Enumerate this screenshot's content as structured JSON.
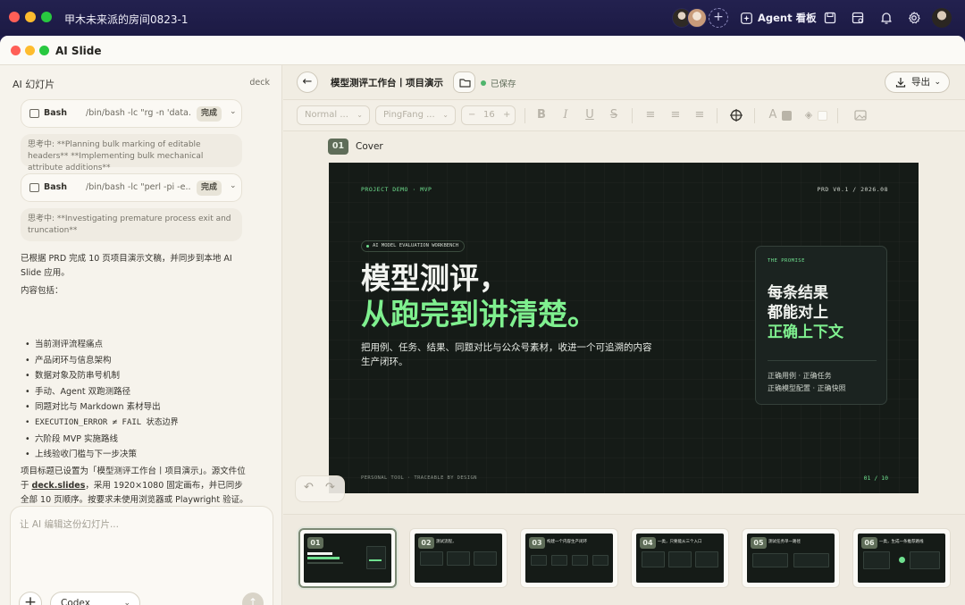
{
  "window": {
    "title": "甲木未来派的房间0823-1",
    "agent_board_label": "Agent 看板",
    "add_member_label": "+"
  },
  "app": {
    "title": "AI Slide"
  },
  "chat": {
    "header_title": "AI 幻灯片",
    "header_tag": "deck",
    "tool_calls": [
      {
        "name": "Bash",
        "command": "/bin/bash -lc \"rg -n 'data...",
        "status": "完成"
      },
      {
        "name": "Bash",
        "command": "/bin/bash -lc \"perl -pi -e...",
        "status": "完成"
      }
    ],
    "thinking": [
      "思考中: **Planning bulk marking of editable headers** **Implementing bulk mechanical attribute additions**",
      "思考中: **Investigating premature process exit and truncation**"
    ],
    "summary_intro": "已根据 PRD 完成 10 页项目演示文稿，并同步到本地 AI Slide 应用。",
    "contents_label": "内容包括：",
    "contents": [
      "当前测评流程痛点",
      "产品闭环与信息架构",
      "数据对象及防串号机制",
      "手动、Agent 双跑测路径",
      "同题对比与 Markdown 素材导出",
      "EXECUTION_ERROR ≠ FAIL 状态边界",
      "六阶段 MVP 实施路线",
      "上线验收门槛与下一步决策"
    ],
    "outro_before": "项目标题已设置为「模型测评工作台丨项目演示」。源文件位于 ",
    "outro_link": "deck.slides",
    "outro_after": "，采用 1920×1080 固定画布，并已同步全部 10 页顺序。按要求未使用浏览器或 Playwright 验证。",
    "input_placeholder": "让 AI 编辑这份幻灯片...",
    "add_label": "+",
    "model_selected": "Codex",
    "send_label": "↑"
  },
  "editor": {
    "back_label": "←",
    "doc_title": "模型测评工作台丨项目演示",
    "saved_status": "已保存",
    "export_label": "导出",
    "toolbar": {
      "paragraph_style": "Normal ...",
      "font_family": "PingFang ...",
      "font_size": "16",
      "minus": "−",
      "plus": "+"
    },
    "current_slide_num": "01",
    "current_slide_name": "Cover",
    "undo": "↶",
    "redo": "↷"
  },
  "slide": {
    "top_left": "PROJECT DEMO · MVP",
    "top_right": "PRD V0.1 / 2026.08",
    "pill": "AI MODEL EVALUATION WORKBENCH",
    "headline_1": "模型测评，",
    "headline_2": "从跑完到讲清楚。",
    "body": "把用例、任务、结果、同题对比与公众号素材，收进一个可追溯的内容生产闭环。",
    "card_kicker": "THE PROMISE",
    "card_line_1": "每条结果",
    "card_line_2": "都能对上",
    "card_line_3": "正确上下文",
    "card_detail_1": "正确用例 · 正确任务",
    "card_detail_2": "正确模型配置 · 正确快照",
    "footer_left": "PERSONAL TOOL · TRACEABLE BY DESIGN",
    "footer_right": "01 / 10"
  },
  "thumbnails": [
    {
      "num": "01",
      "title": ""
    },
    {
      "num": "02",
      "title": "测试流程，"
    },
    {
      "num": "03",
      "title": "构建一个内容生产闭环"
    },
    {
      "num": "04",
      "title": "一类，只要能从三个入口"
    },
    {
      "num": "05",
      "title": "测试任务单一路径"
    },
    {
      "num": "06",
      "title": "一类，生成一条推荐路线"
    }
  ],
  "colors": {
    "slide_bg": "#151b17",
    "accent_green": "#7ff08f",
    "tag_green": "#5f6d59",
    "window_bar": "#1f1d4a",
    "app_bg": "#f1ede3"
  }
}
